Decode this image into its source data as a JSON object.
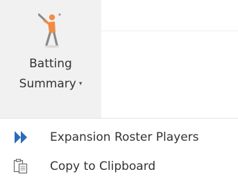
{
  "ribbon": {
    "button": {
      "icon": "baseball-batter-icon",
      "label_line1": "Batting",
      "label_line2": "Summary",
      "dropdown_caret": "▾"
    }
  },
  "menu": {
    "items": [
      {
        "label": "Expansion Roster Players",
        "icon": "fast-forward-icon",
        "color": "#2b6cb6"
      },
      {
        "label": "Copy to Clipboard",
        "icon": "copy-clipboard-icon"
      }
    ]
  },
  "colors": {
    "batter_orange": "#f28b45",
    "batter_gray": "#8a8a8a",
    "menu_blue": "#2b6cb6",
    "button_bg": "#f1f1f1"
  }
}
